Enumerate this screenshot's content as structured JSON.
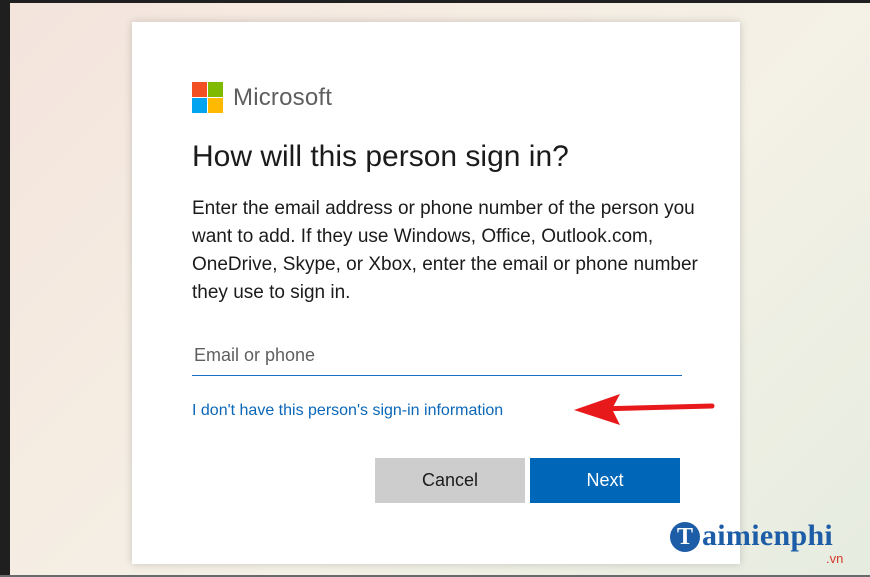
{
  "logo": {
    "wordmark": "Microsoft",
    "colors": [
      "#f25022",
      "#7fba00",
      "#00a4ef",
      "#ffb900"
    ]
  },
  "dialog": {
    "title": "How will this person sign in?",
    "description": "Enter the email address or phone number of the person you want to add. If they use Windows, Office, Outlook.com, OneDrive, Skype, or Xbox, enter the email or phone number they use to sign in.",
    "email_field": {
      "placeholder": "Email or phone",
      "value": ""
    },
    "no_info_link": "I don't have this person's sign-in information",
    "buttons": {
      "cancel": "Cancel",
      "next": "Next"
    }
  },
  "annotation": {
    "arrow_color": "#e8191b"
  },
  "watermark": {
    "logo_letter": "T",
    "brand": "aimienphi",
    "tld": ".vn"
  },
  "colors": {
    "accent": "#0067b8",
    "link": "#0b67b8",
    "cancel_bg": "#cdcdcd"
  }
}
